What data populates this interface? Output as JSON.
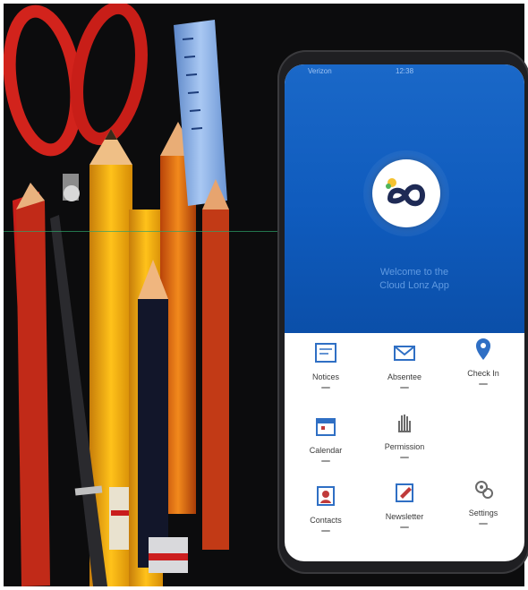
{
  "status": {
    "left": "Verizon",
    "center": "12:38"
  },
  "welcome": {
    "line1": "Welcome to the",
    "line2": "Cloud Lonz App"
  },
  "menu": [
    {
      "label": "Notices",
      "icon": "notice-board-icon"
    },
    {
      "label": "Absentee",
      "icon": "envelope-icon"
    },
    {
      "label": "Check In",
      "icon": "location-pin-icon"
    },
    {
      "label": "Calendar",
      "icon": "calendar-icon"
    },
    {
      "label": "Permission",
      "icon": "permission-hand-icon"
    },
    {
      "label": "Contacts",
      "icon": "contacts-icon"
    },
    {
      "label": "Newsletter",
      "icon": "newsletter-icon"
    },
    {
      "label": "Settings",
      "icon": "settings-icon"
    }
  ],
  "colors": {
    "header_blue": "#1062c4",
    "icon_blue": "#2f6fc4",
    "icon_red": "#c03a3a"
  }
}
